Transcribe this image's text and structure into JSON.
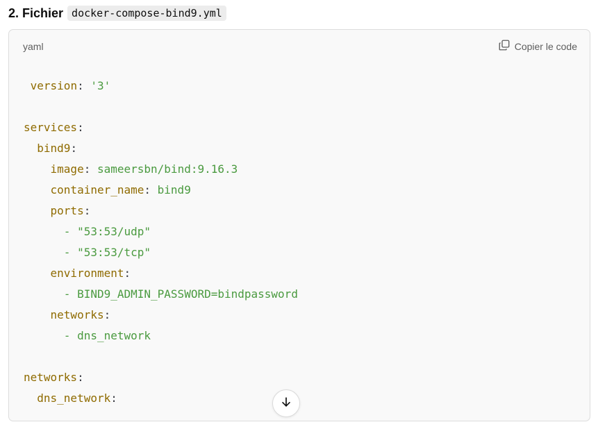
{
  "heading": {
    "number": "2.",
    "label": "Fichier",
    "filename": "docker-compose-bind9.yml"
  },
  "code_block": {
    "language": "yaml",
    "copy_label": "Copier le code",
    "lines": [
      {
        "indent": " ",
        "key": "version",
        "sep": ": ",
        "value": "'3'"
      },
      {
        "indent": "",
        "key": "",
        "sep": "",
        "value": ""
      },
      {
        "indent": "",
        "key": "services",
        "sep": ":",
        "value": ""
      },
      {
        "indent": "  ",
        "key": "bind9",
        "sep": ":",
        "value": ""
      },
      {
        "indent": "    ",
        "key": "image",
        "sep": ": ",
        "value": "sameersbn/bind:9.16.3"
      },
      {
        "indent": "    ",
        "key": "container_name",
        "sep": ": ",
        "value": "bind9"
      },
      {
        "indent": "    ",
        "key": "ports",
        "sep": ":",
        "value": ""
      },
      {
        "indent": "      ",
        "key": "",
        "sep": "- ",
        "value": "\"53:53/udp\""
      },
      {
        "indent": "      ",
        "key": "",
        "sep": "- ",
        "value": "\"53:53/tcp\""
      },
      {
        "indent": "    ",
        "key": "environment",
        "sep": ":",
        "value": ""
      },
      {
        "indent": "      ",
        "key": "",
        "sep": "- ",
        "value": "BIND9_ADMIN_PASSWORD=bindpassword"
      },
      {
        "indent": "    ",
        "key": "networks",
        "sep": ":",
        "value": ""
      },
      {
        "indent": "      ",
        "key": "",
        "sep": "- ",
        "value": "dns_network"
      },
      {
        "indent": "",
        "key": "",
        "sep": "",
        "value": ""
      },
      {
        "indent": "",
        "key": "networks",
        "sep": ":",
        "value": ""
      },
      {
        "indent": "  ",
        "key": "dns_network",
        "sep": ":",
        "value": ""
      }
    ]
  },
  "icons": {
    "copy": "copy-icon",
    "scroll_down": "arrow-down-icon"
  },
  "colors": {
    "key": "#8f6b00",
    "string": "#4a9a3f",
    "background": "#f9f9f9"
  }
}
